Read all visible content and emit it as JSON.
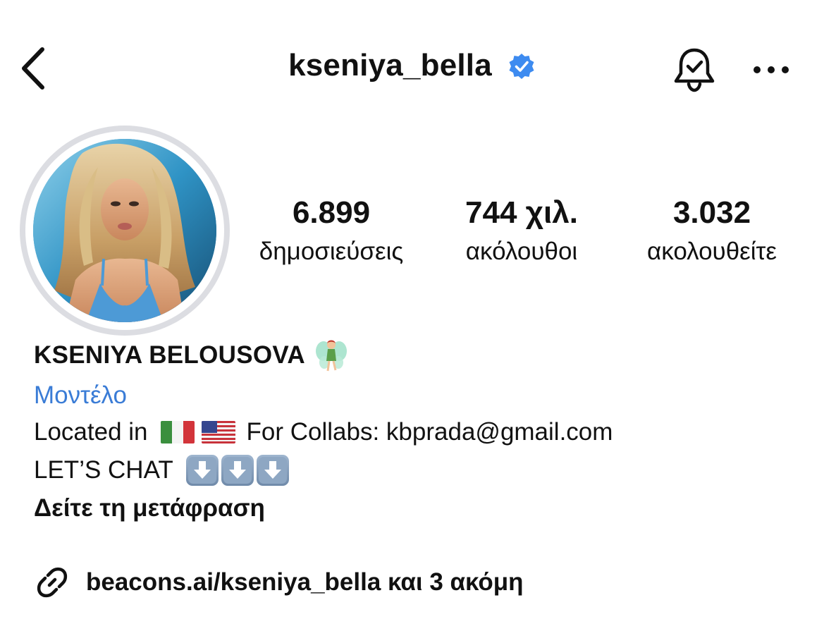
{
  "header": {
    "username": "kseniya_bella",
    "verified": true,
    "back_icon": "chevron-left-icon",
    "bell_icon": "bell-check-icon",
    "more_icon": "more-horizontal-icon"
  },
  "stats": [
    {
      "value": "6.899",
      "label": "δημοσιεύσεις"
    },
    {
      "value": "744 χιλ.",
      "label": "ακόλουθοι"
    },
    {
      "value": "3.032",
      "label": "ακολουθείτε"
    }
  ],
  "profile": {
    "full_name": "KSENIYA BELOUSOVA",
    "name_emoji": "fairy-emoji",
    "category": "Μοντέλο",
    "bio_line1_prefix": "Located in",
    "bio_line1_suffix": "For Collabs: kbprada@gmail.com",
    "bio_line2": "LET’S CHAT",
    "flags": [
      "italy-flag",
      "usa-flag"
    ],
    "arrow_emojis": [
      "down-arrow-emoji",
      "down-arrow-emoji",
      "down-arrow-emoji"
    ],
    "translate_label": "Δείτε τη μετάφραση",
    "link_text": "beacons.ai/kseniya_bella και 3 ακόμη",
    "link_icon": "link-icon"
  },
  "colors": {
    "text": "#111111",
    "category": "#3a7cd6",
    "verified": "#3d8bf0",
    "avatar_ring": "#dcdde2"
  }
}
